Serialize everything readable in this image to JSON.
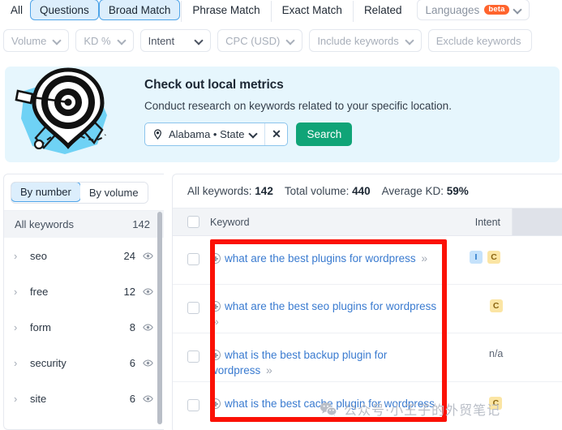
{
  "tabs": [
    {
      "label": "All",
      "active": false
    },
    {
      "label": "Questions",
      "active": true
    },
    {
      "label": "Broad Match",
      "active": true
    },
    {
      "label": "Phrase Match",
      "active": false
    },
    {
      "label": "Exact Match",
      "active": false
    },
    {
      "label": "Related",
      "active": false
    }
  ],
  "languages": {
    "label": "Languages",
    "badge": "beta"
  },
  "filters": [
    {
      "label": "Volume",
      "chevron": true,
      "dark": false
    },
    {
      "label": "KD %",
      "chevron": true,
      "dark": false
    },
    {
      "label": "Intent",
      "chevron": true,
      "dark": true,
      "wide": true
    },
    {
      "label": "CPC (USD)",
      "chevron": true,
      "dark": false
    },
    {
      "label": "Include keywords",
      "chevron": true,
      "dark": false
    },
    {
      "label": "Exclude keywords",
      "chevron": false,
      "dark": false
    }
  ],
  "banner": {
    "title": "Check out local metrics",
    "subtitle": "Conduct research on keywords related to your specific location.",
    "location_value": "Alabama • State",
    "clear_label": "✕",
    "search_label": "Search",
    "accent_green": "#10a477",
    "background": "#e6f6fd"
  },
  "sidebar": {
    "segmented": [
      {
        "label": "By number",
        "selected": true
      },
      {
        "label": "By volume",
        "selected": false
      }
    ],
    "all_keywords": {
      "label": "All keywords",
      "count": "142"
    },
    "groups": [
      {
        "label": "seo",
        "count": "24"
      },
      {
        "label": "free",
        "count": "12"
      },
      {
        "label": "form",
        "count": "8"
      },
      {
        "label": "security",
        "count": "6"
      },
      {
        "label": "site",
        "count": "6"
      }
    ]
  },
  "table": {
    "summary": {
      "all_keywords_label": "All keywords:",
      "all_keywords_value": "142",
      "total_volume_label": "Total volume:",
      "total_volume_value": "440",
      "average_kd_label": "Average KD:",
      "average_kd_value": "59%"
    },
    "columns": {
      "keyword": "Keyword",
      "intent": "Intent"
    },
    "rows": [
      {
        "keyword": "what are the best plugins for wordpress",
        "expand": "»",
        "intent_badges": [
          "I",
          "C"
        ],
        "intent_text": ""
      },
      {
        "keyword": "what are the best seo plugins for wordpress",
        "expand": "»",
        "intent_badges": [
          "C"
        ],
        "intent_text": ""
      },
      {
        "keyword": "what is the best backup plugin for wordpress",
        "expand": "»",
        "intent_badges": [],
        "intent_text": "n/a"
      },
      {
        "keyword": "what is the best cache plugin for wordpress",
        "expand": "»",
        "intent_badges": [
          "C"
        ],
        "intent_text": ""
      }
    ],
    "badge_colors": {
      "I": "#c5e2fb",
      "C": "#fbe5a4"
    }
  },
  "annotation": {
    "box_color": "#fb1106"
  },
  "watermark": {
    "text": "公众号·小王子的外贸笔记"
  }
}
